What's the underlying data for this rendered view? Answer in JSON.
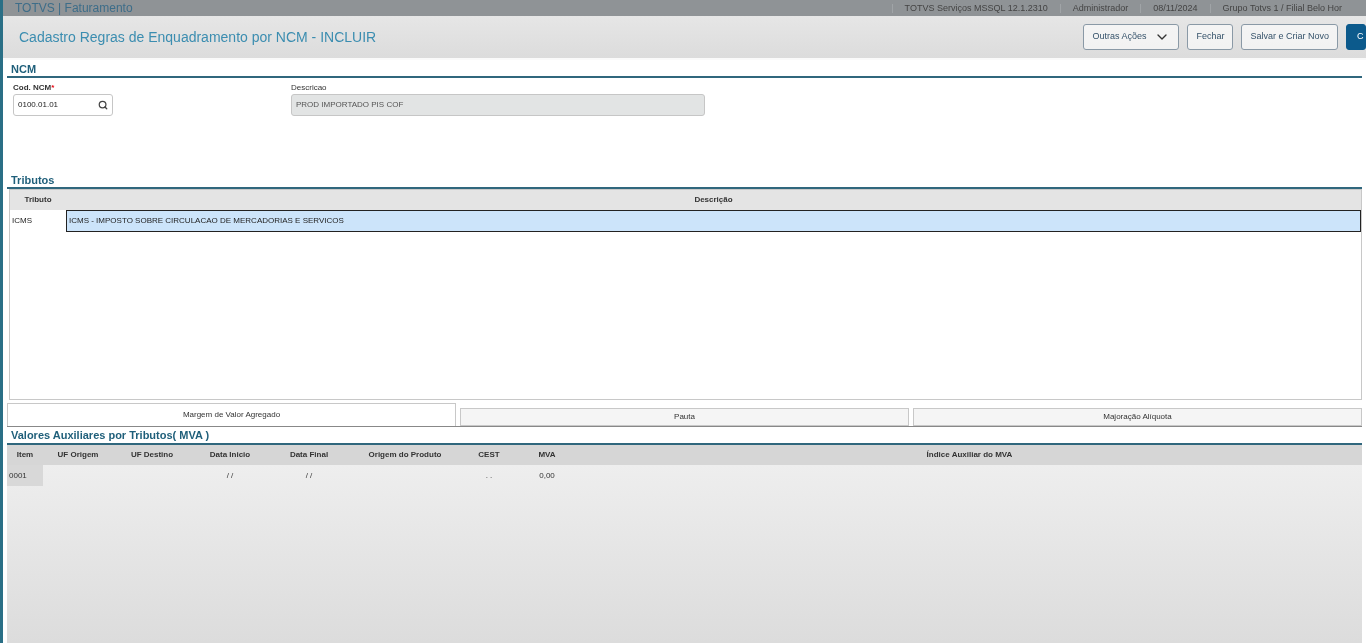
{
  "top_bar": {
    "app_title": "TOTVS | Faturamento",
    "info": [
      "TOTVS Serviços MSSQL 12.1.2310",
      "Administrador",
      "08/11/2024",
      "Grupo Totvs 1 / Filial Belo Hor"
    ]
  },
  "header": {
    "title": "Cadastro Regras de Enquadramento por NCM - INCLUIR",
    "buttons": [
      {
        "label": "Outras Ações",
        "kind": "dropdown"
      },
      {
        "label": "Fechar",
        "kind": "plain"
      },
      {
        "label": "Salvar e Criar Novo",
        "kind": "plain"
      },
      {
        "label": "C",
        "kind": "primary"
      }
    ]
  },
  "ncm": {
    "title": "NCM",
    "cod_label": "Cod. NCM",
    "required_mark": "*",
    "cod_value": "0100.01.01",
    "desc_label": "Descricao",
    "desc_value": "PROD IMPORTADO PIS COF"
  },
  "tributos": {
    "title": "Tributos",
    "columns": [
      "Tributo",
      "Descrição"
    ],
    "rows": [
      {
        "tributo": "ICMS",
        "descricao": "ICMS - IMPOSTO SOBRE CIRCULACAO DE MERCADORIAS E SERVICOS",
        "selected": true
      }
    ]
  },
  "tabs": [
    {
      "label": "Margem de Valor Agregado",
      "selected": true
    },
    {
      "label": "Pauta",
      "selected": false
    },
    {
      "label": "Majoração Alíquota",
      "selected": false
    }
  ],
  "mva": {
    "title": "Valores Auxiliares por Tributos( MVA )",
    "columns": [
      "Item",
      "UF Origem",
      "UF Destino",
      "Data Inicio",
      "Data Final",
      "Origem do Produto",
      "CEST",
      "MVA",
      "Índice Auxiliar do MVA"
    ],
    "rows": [
      {
        "cells": [
          "0001",
          null,
          null,
          "/ /",
          "/ /",
          null,
          ". .",
          "0,00",
          null
        ]
      }
    ]
  }
}
